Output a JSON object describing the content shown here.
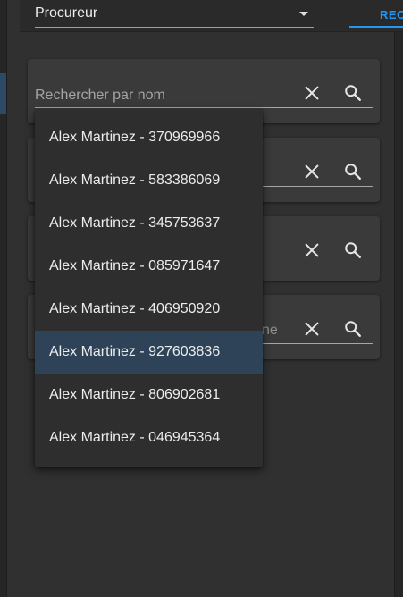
{
  "header": {
    "select_value": "Procureur",
    "tab_label": "REC"
  },
  "search_fields": [
    {
      "placeholder": "Rechercher par nom",
      "hint_tail": ""
    },
    {
      "placeholder": "",
      "hint_tail": ""
    },
    {
      "placeholder": "",
      "hint_tail": ""
    },
    {
      "placeholder": "",
      "hint_tail": "ne"
    }
  ],
  "dropdown": {
    "options": [
      "Alex Martinez - 370969966",
      "Alex Martinez - 583386069",
      "Alex Martinez - 345753637",
      "Alex Martinez - 085971647",
      "Alex Martinez - 406950920",
      "Alex Martinez - 927603836",
      "Alex Martinez - 806902681",
      "Alex Martinez - 046945364"
    ],
    "selected_index": 5
  },
  "icons": {
    "clear": "close-icon",
    "search": "search-icon",
    "caret": "caret-down-icon"
  },
  "colors": {
    "accent": "#2196f3",
    "selected_option": "#2e4357",
    "card": "#3a3a3a",
    "background": "#303030"
  }
}
